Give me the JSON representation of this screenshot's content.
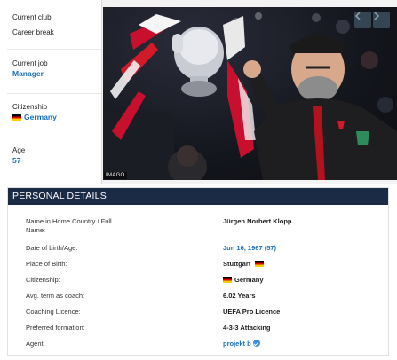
{
  "sidebar": {
    "club": {
      "label": "Current club",
      "value": "Career break"
    },
    "job": {
      "label": "Current job",
      "value": "Manager"
    },
    "citizenship": {
      "label": "Citizenship",
      "value": "Germany"
    },
    "age": {
      "label": "Age",
      "value": "57"
    }
  },
  "photo": {
    "credit": "IMAGO",
    "prev_icon": "chevron-left-icon",
    "next_icon": "chevron-right-icon"
  },
  "personal_details": {
    "title": "PERSONAL DETAILS",
    "rows": [
      {
        "label": "Name in Home Country / Full Name:",
        "value": "Jürgen Norbert Klopp"
      },
      {
        "label": "Date of birth/Age:",
        "value": "Jun 16, 1967 (57)"
      },
      {
        "label": "Place of Birth:",
        "value": "Stuttgart"
      },
      {
        "label": "Citizenship:",
        "value": "Germany"
      },
      {
        "label": "Avg. term as coach:",
        "value": "6.02 Years"
      },
      {
        "label": "Coaching Licence:",
        "value": "UEFA Pro Licence"
      },
      {
        "label": "Preferred formation:",
        "value": "4-3-3 Attacking"
      },
      {
        "label": "Agent:",
        "value": "projekt b"
      }
    ]
  },
  "colors": {
    "header_bg": "#1b2a45",
    "link": "#1a6fb5",
    "nav_button": "#3a4f5e"
  }
}
